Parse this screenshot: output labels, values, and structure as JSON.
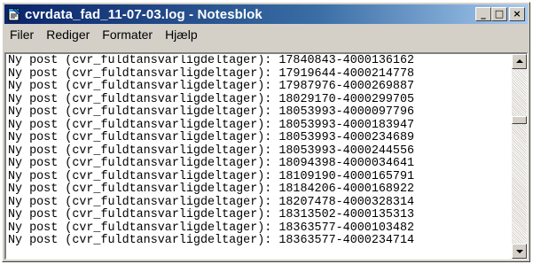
{
  "window": {
    "title": "cvrdata_fad_11-07-03.log - Notesblok",
    "buttons": {
      "minimize_glyph": "_",
      "maximize_glyph": "□",
      "close_glyph": "×"
    },
    "accent_color": "#0a246a",
    "icon": "notepad-icon"
  },
  "menu": {
    "items": [
      {
        "label": "Filer"
      },
      {
        "label": "Rediger"
      },
      {
        "label": "Formater"
      },
      {
        "label": "Hjælp"
      }
    ]
  },
  "document": {
    "lines": [
      "Ny post (cvr_fuldtansvarligdeltager): 17840843-4000136162",
      "Ny post (cvr_fuldtansvarligdeltager): 17919644-4000214778",
      "Ny post (cvr_fuldtansvarligdeltager): 17987976-4000269887",
      "Ny post (cvr_fuldtansvarligdeltager): 18029170-4000299705",
      "Ny post (cvr_fuldtansvarligdeltager): 18053993-4000097796",
      "Ny post (cvr_fuldtansvarligdeltager): 18053993-4000183947",
      "Ny post (cvr_fuldtansvarligdeltager): 18053993-4000234689",
      "Ny post (cvr_fuldtansvarligdeltager): 18053993-4000244556",
      "Ny post (cvr_fuldtansvarligdeltager): 18094398-4000034641",
      "Ny post (cvr_fuldtansvarligdeltager): 18109190-4000165791",
      "Ny post (cvr_fuldtansvarligdeltager): 18184206-4000168922",
      "Ny post (cvr_fuldtansvarligdeltager): 18207478-4000328314",
      "Ny post (cvr_fuldtansvarligdeltager): 18313502-4000135313",
      "Ny post (cvr_fuldtansvarligdeltager): 18363577-4000103482",
      "Ny post (cvr_fuldtansvarligdeltager): 18363577-4000234714"
    ]
  },
  "scrollbar": {
    "position_fraction": 0.28
  }
}
